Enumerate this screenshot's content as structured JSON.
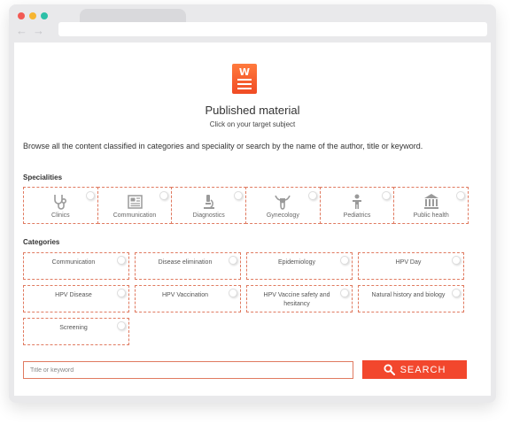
{
  "browser": {
    "dot_colors": [
      "#f25a54",
      "#f7b531",
      "#2cc0a8"
    ],
    "back_glyph": "←",
    "forward_glyph": "→"
  },
  "colors": {
    "accent": "#f2472d",
    "card_border": "#e07a60"
  },
  "logo": {
    "text": "W",
    "icon": "document-logo-icon"
  },
  "header": {
    "title": "Published material",
    "subtitle": "Click on your target subject"
  },
  "description": "Browse all the content classified in categories and speciality or search by the name of the author, title or keyword.",
  "specialities": {
    "label": "Specialities",
    "items": [
      {
        "label": "Clinics",
        "icon": "stethoscope-icon"
      },
      {
        "label": "Communication",
        "icon": "newspaper-icon"
      },
      {
        "label": "Diagnostics",
        "icon": "microscope-icon"
      },
      {
        "label": "Gynecology",
        "icon": "uterus-icon"
      },
      {
        "label": "Pediatrics",
        "icon": "child-icon"
      },
      {
        "label": "Public health",
        "icon": "building-icon"
      }
    ]
  },
  "categories": {
    "label": "Categories",
    "items": [
      {
        "label": "Communication"
      },
      {
        "label": "Disease elimination"
      },
      {
        "label": "Epidemiology"
      },
      {
        "label": "HPV Day"
      },
      {
        "label": "HPV Disease"
      },
      {
        "label": "HPV Vaccination"
      },
      {
        "label": "HPV Vaccine safety and hesitancy"
      },
      {
        "label": "Natural history and biology"
      },
      {
        "label": "Screening"
      }
    ]
  },
  "search": {
    "placeholder": "Title or keyword",
    "button_label": "SEARCH",
    "button_icon": "search-icon"
  }
}
